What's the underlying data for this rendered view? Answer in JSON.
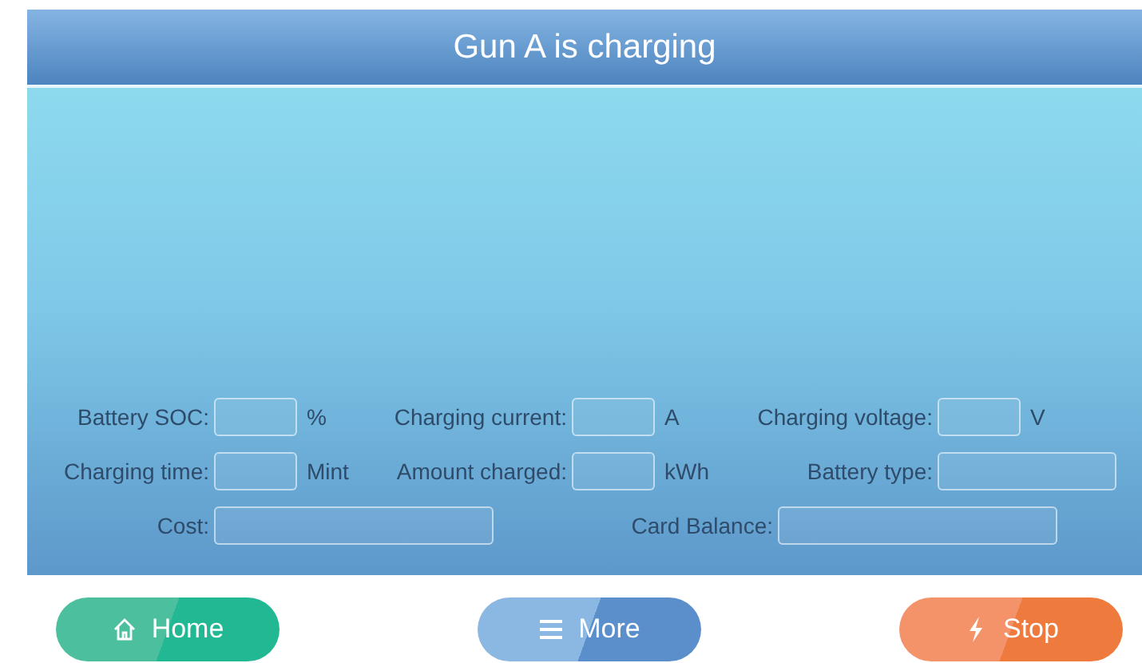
{
  "title": "Gun A is charging",
  "rows": [
    [
      {
        "label": "Battery SOC:",
        "kind": "short",
        "unit": "%"
      },
      {
        "label": "Charging current:",
        "kind": "short",
        "unit": "A"
      },
      {
        "label": "Charging voltage:",
        "kind": "short",
        "unit": "V"
      }
    ],
    [
      {
        "label": "Charging time:",
        "kind": "short",
        "unit": "Mint"
      },
      {
        "label": "Amount charged:",
        "kind": "short",
        "unit": "kWh"
      },
      {
        "label": "Battery type:",
        "kind": "wide"
      }
    ],
    [
      {
        "label": "Cost:",
        "kind": "long"
      },
      {
        "label": "Card Balance:",
        "kind": "long"
      }
    ]
  ],
  "buttons": [
    {
      "label": "Home",
      "kind": "home"
    },
    {
      "label": "More",
      "kind": "menu"
    },
    {
      "label": "Stop",
      "kind": "stop"
    }
  ]
}
